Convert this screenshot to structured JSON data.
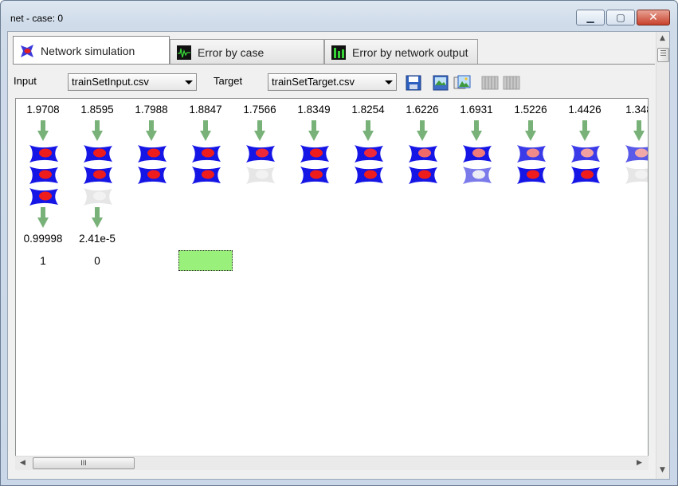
{
  "window": {
    "title": "net - case: 0"
  },
  "tabs": [
    {
      "label": "Network simulation",
      "icon": "network-icon",
      "active": true
    },
    {
      "label": "Error by case",
      "icon": "waveform-chart-icon",
      "active": false
    },
    {
      "label": "Error by network output",
      "icon": "bar-chart-icon",
      "active": false
    }
  ],
  "toolbar": {
    "input_label": "Input",
    "input_file": "trainSetInput.csv",
    "target_label": "Target",
    "target_file": "trainSetTarget.csv",
    "icons": [
      "save-icon",
      "image-save-icon",
      "image-copy-icon",
      "grid-icon",
      "grid-icon"
    ]
  },
  "simulation": {
    "inputs": [
      "1.9708",
      "1.8595",
      "1.7988",
      "1.8847",
      "1.7566",
      "1.8349",
      "1.8254",
      "1.6226",
      "1.6931",
      "1.5226",
      "1.4426",
      "1.348"
    ],
    "outputs": [
      "0.99998",
      "2.41e-5"
    ],
    "targets": [
      "1",
      "0"
    ],
    "colors": {
      "arrow": "#79b279",
      "neuron_blue": "#1515e6",
      "neuron_red": "#ee1c1c",
      "target_box": "#99f07a"
    }
  },
  "scrollbar": {
    "thumb_label": "III"
  }
}
